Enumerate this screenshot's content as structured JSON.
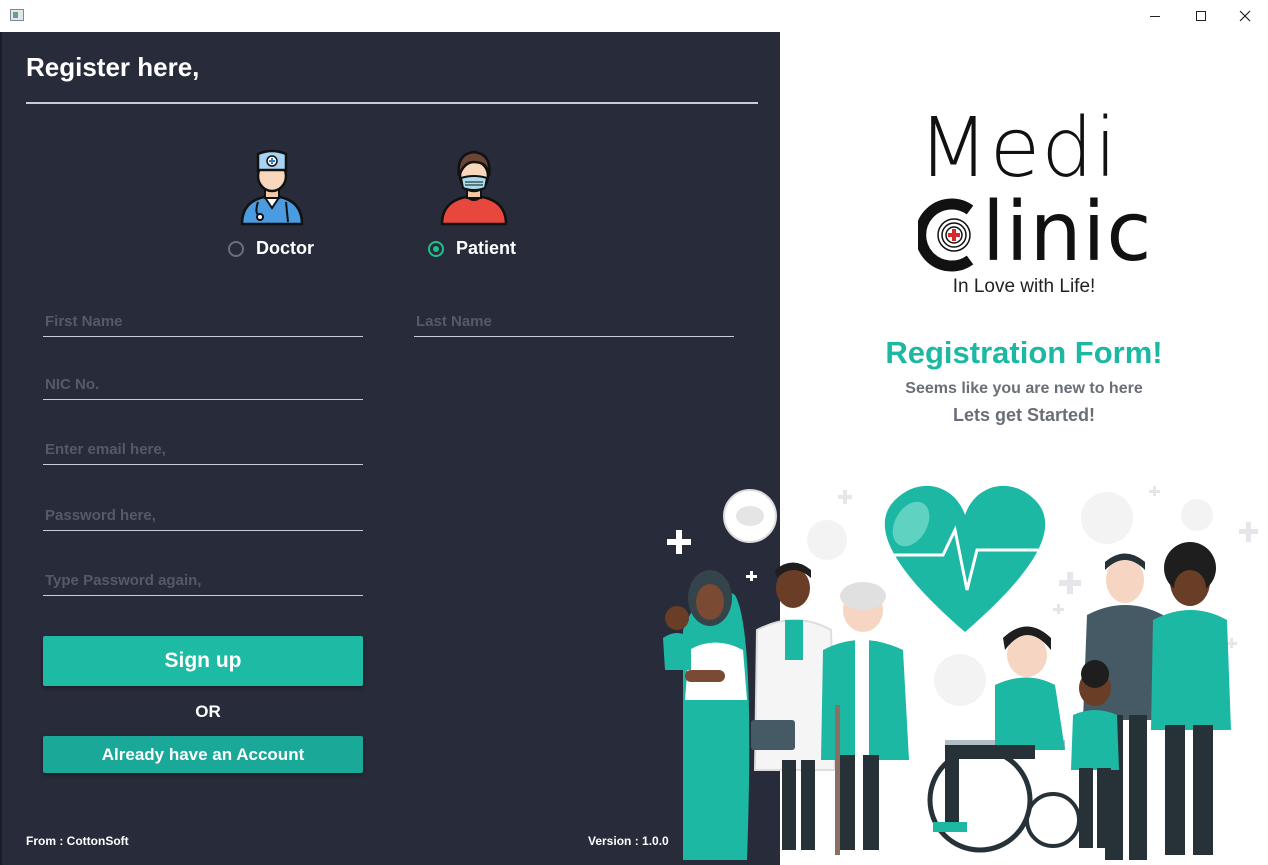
{
  "window": {
    "minimize_icon": "minimize-icon",
    "maximize_icon": "maximize-icon",
    "close_icon": "close-icon"
  },
  "form": {
    "title": "Register here,",
    "roles": [
      {
        "label": "Doctor",
        "selected": false,
        "icon": "doctor-icon"
      },
      {
        "label": "Patient",
        "selected": true,
        "icon": "patient-icon"
      }
    ],
    "fields": {
      "first_name": {
        "value": "",
        "placeholder": "First Name"
      },
      "last_name": {
        "value": "",
        "placeholder": "Last Name"
      },
      "nic": {
        "value": "",
        "placeholder": "NIC No."
      },
      "email": {
        "value": "",
        "placeholder": "Enter email here,"
      },
      "password": {
        "value": "",
        "placeholder": "Password here,"
      },
      "confirm_password": {
        "value": "",
        "placeholder": "Type Password again,"
      }
    },
    "signup_label": "Sign up",
    "or_label": "OR",
    "account_label": "Already have an Account",
    "footer_from": "From : CottonSoft",
    "footer_version": "Version : 1.0.0"
  },
  "brand": {
    "name_line1": "Medi",
    "name_line2": "linic",
    "tagline": "In Love with Life!",
    "heading": "Registration Form!",
    "subheading": "Seems like you are new to here",
    "cta": "Lets get Started!"
  },
  "colors": {
    "panel": "#282b3a",
    "accent": "#1dbba4",
    "radio_checked": "#20c08a"
  }
}
